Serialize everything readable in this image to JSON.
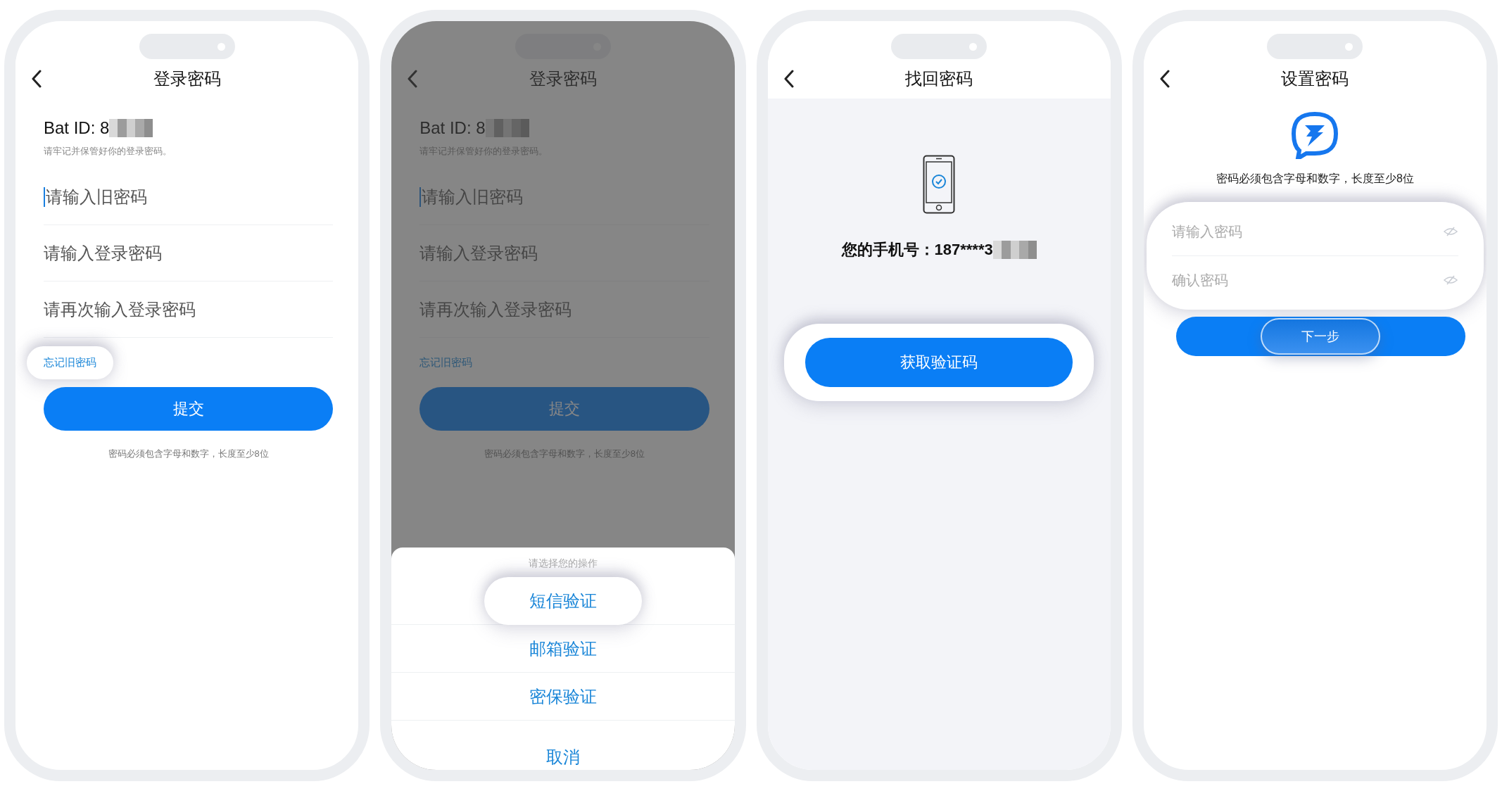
{
  "screens": [
    {
      "kind": "change_password",
      "title": "登录密码",
      "dimmed": false,
      "account_label": "Bat ID: 8",
      "redacted": true,
      "hint": "请牢记并保管好你的登录密码。",
      "fields": [
        {
          "placeholder": "请输入旧密码",
          "focused": true
        },
        {
          "placeholder": "请输入登录密码",
          "focused": false
        },
        {
          "placeholder": "请再次输入登录密码",
          "focused": false
        }
      ],
      "link": {
        "label": "忘记旧密码",
        "highlighted": true
      },
      "button": "提交",
      "note": "密码必须包含字母和数字，长度至少8位"
    },
    {
      "kind": "change_password",
      "title": "登录密码",
      "dimmed": true,
      "account_label": "Bat ID: 8",
      "redacted": true,
      "hint": "请牢记并保管好你的登录密码。",
      "fields": [
        {
          "placeholder": "请输入旧密码",
          "focused": true
        },
        {
          "placeholder": "请输入登录密码",
          "focused": false
        },
        {
          "placeholder": "请再次输入登录密码",
          "focused": false
        }
      ],
      "link": {
        "label": "忘记旧密码",
        "highlighted": false
      },
      "button": "提交",
      "note": "密码必须包含字母和数字，长度至少8位",
      "sheet": {
        "title": "请选择您的操作",
        "options": [
          {
            "label": "短信验证",
            "highlighted": true
          },
          {
            "label": "邮箱验证",
            "highlighted": false
          },
          {
            "label": "密保验证",
            "highlighted": false
          }
        ],
        "cancel": "取消"
      }
    },
    {
      "kind": "verify_phone",
      "title": "找回密码",
      "phone_label": "您的手机号：187****3",
      "redacted": true,
      "button": {
        "label": "获取验证码",
        "highlighted": true
      }
    },
    {
      "kind": "set_password",
      "title": "设置密码",
      "note": "密码必须包含字母和数字，长度至少8位",
      "fields_highlighted": true,
      "fields": [
        {
          "placeholder": "请输入密码"
        },
        {
          "placeholder": "确认密码"
        }
      ],
      "button": {
        "label": "下一步",
        "highlighted": true
      }
    }
  ]
}
